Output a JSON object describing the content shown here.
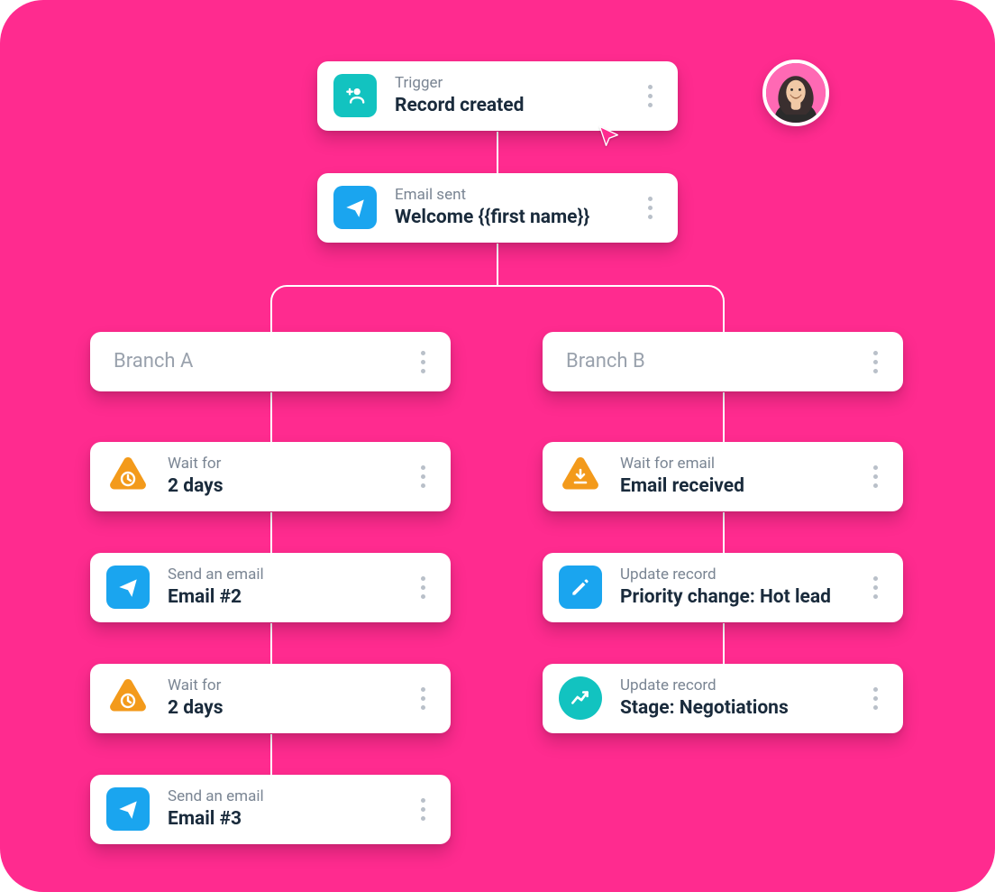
{
  "colors": {
    "background": "#ff2b8f",
    "teal": "#12c3c0",
    "blue": "#1aa5ef",
    "orange": "#f39a1b",
    "cursor": "#ff2b8f",
    "textMuted": "#7a8593",
    "text": "#1a2b3c"
  },
  "avatar": {
    "alt": "User avatar"
  },
  "flow": {
    "trigger": {
      "label": "Trigger",
      "title": "Record created",
      "icon": "add-person-icon",
      "iconColor": "teal"
    },
    "emailSent": {
      "label": "Email sent",
      "title": "Welcome {{first name}}",
      "icon": "send-icon",
      "iconColor": "blue"
    },
    "branches": [
      {
        "name": "Branch A",
        "steps": [
          {
            "label": "Wait for",
            "title": "2 days",
            "icon": "clock-triangle-icon",
            "iconColor": "orange"
          },
          {
            "label": "Send an email",
            "title": "Email #2",
            "icon": "send-icon",
            "iconColor": "blue"
          },
          {
            "label": "Wait for",
            "title": "2 days",
            "icon": "clock-triangle-icon",
            "iconColor": "orange"
          },
          {
            "label": "Send an email",
            "title": "Email #3",
            "icon": "send-icon",
            "iconColor": "blue"
          }
        ]
      },
      {
        "name": "Branch B",
        "steps": [
          {
            "label": "Wait for email",
            "title": "Email received",
            "icon": "download-triangle-icon",
            "iconColor": "orange"
          },
          {
            "label": "Update record",
            "title": "Priority change: Hot lead",
            "icon": "edit-icon",
            "iconColor": "blue"
          },
          {
            "label": "Update record",
            "title": "Stage: Negotiations",
            "icon": "trend-icon",
            "iconColor": "teal",
            "circle": true
          }
        ]
      }
    ]
  }
}
